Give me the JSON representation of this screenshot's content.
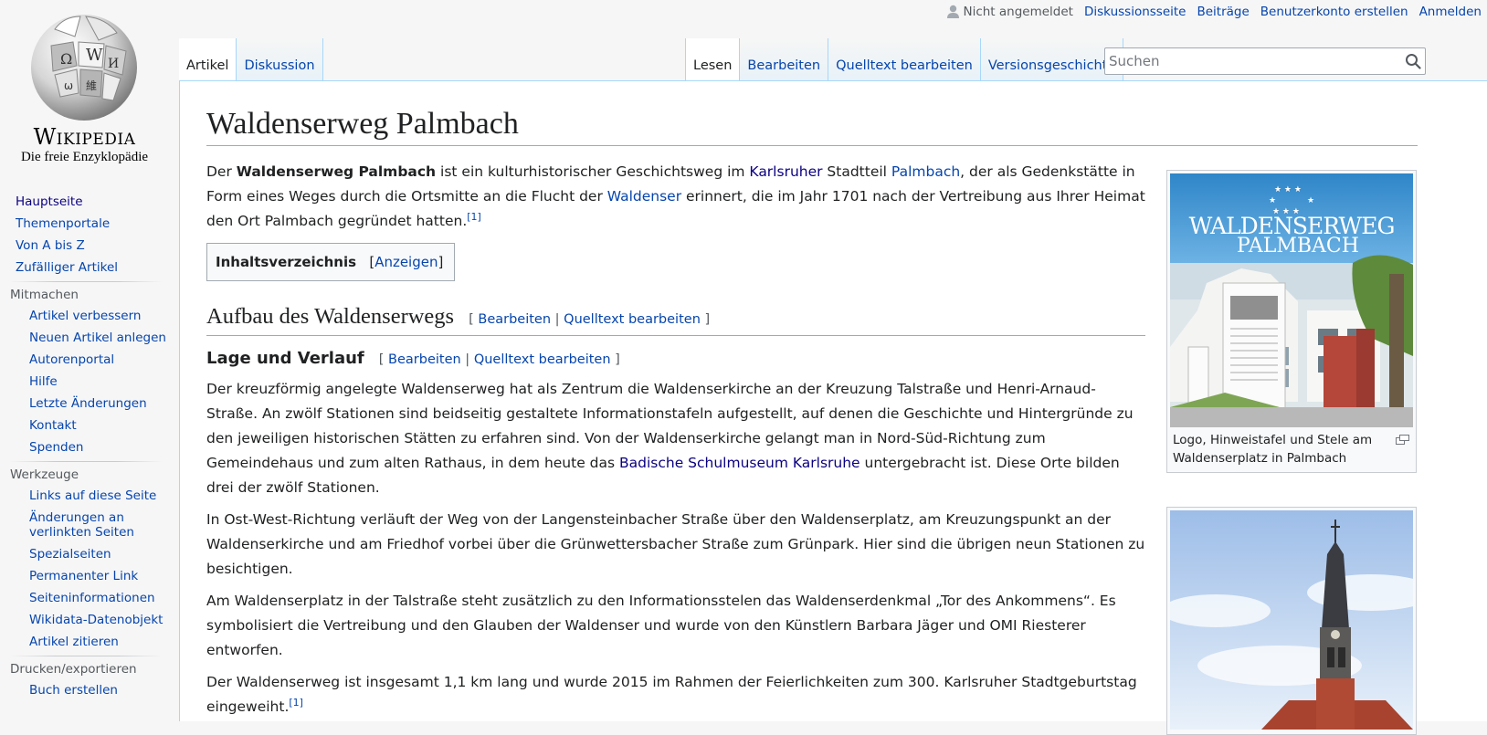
{
  "logo": {
    "wordmark": "Wikipedia",
    "tagline": "Die freie Enzyklopädie"
  },
  "personal": {
    "user_status": "Nicht angemeldet",
    "links": [
      "Diskussionsseite",
      "Beiträge",
      "Benutzerkonto erstellen",
      "Anmelden"
    ]
  },
  "tabs": {
    "namespaces": [
      {
        "label": "Artikel",
        "selected": true
      },
      {
        "label": "Diskussion",
        "selected": false
      }
    ],
    "views": [
      {
        "label": "Lesen",
        "selected": true
      },
      {
        "label": "Bearbeiten",
        "selected": false
      },
      {
        "label": "Quelltext bearbeiten",
        "selected": false
      },
      {
        "label": "Versionsgeschichte",
        "selected": false
      }
    ]
  },
  "search": {
    "placeholder": "Suchen",
    "value": ""
  },
  "sidebar": {
    "navigation": [
      "Hauptseite",
      "Themenportale",
      "Von A bis Z",
      "Zufälliger Artikel"
    ],
    "mitmachen": {
      "heading": "Mitmachen",
      "items": [
        "Artikel verbessern",
        "Neuen Artikel anlegen",
        "Autorenportal",
        "Hilfe",
        "Letzte Änderungen",
        "Kontakt",
        "Spenden"
      ]
    },
    "werkzeuge": {
      "heading": "Werkzeuge",
      "items": [
        "Links auf diese Seite",
        "Änderungen an verlinkten Seiten",
        "Spezialseiten",
        "Permanenter Link",
        "Seiteninformationen",
        "Wikidata-Datenobjekt",
        "Artikel zitieren"
      ]
    },
    "drucken": {
      "heading": "Drucken/exportieren",
      "items": [
        "Buch erstellen"
      ]
    }
  },
  "article": {
    "title": "Waldenserweg Palmbach",
    "intro": {
      "t1": "Der ",
      "bold": "Waldenserweg Palmbach",
      "t2": " ist ein kulturhistorischer Geschichtsweg im ",
      "l1": "Karlsruher",
      "t3": " Stadtteil ",
      "l2": "Palmbach",
      "t4": ", der als Gedenkstätte in Form eines Weges durch die Ortsmitte an die Flucht der ",
      "l3": "Waldenser",
      "t5": " erinnert, die im Jahr 1701 nach der Vertreibung aus Ihrer Heimat den Ort Palmbach gegründet hatten.",
      "ref": "[1]"
    },
    "toc": {
      "title": "Inhaltsverzeichnis",
      "open": "[",
      "toggle": "Anzeigen",
      "close": "]"
    },
    "edit": {
      "open": "[ ",
      "edit": "Bearbeiten",
      "sep": " | ",
      "source": "Quelltext bearbeiten",
      "close": " ]"
    },
    "section1": "Aufbau des Waldenserwegs",
    "subsection1": "Lage und Verlauf",
    "p1": {
      "t1": "Der kreuzförmig angelegte Waldenserweg hat als Zentrum die Waldenserkirche an der Kreuzung Talstraße und Henri-Arnaud-Straße. An zwölf Stationen sind beidseitig gestaltete Informationstafeln aufgestellt, auf denen die Geschichte und Hintergründe zu den jeweiligen historischen Stätten zu erfahren sind. Von der Waldenserkirche gelangt man in Nord-Süd-Richtung zum Gemeindehaus und zum alten Rathaus, in dem heute das ",
      "link": "Badische Schulmuseum Karlsruhe",
      "t2": " untergebracht ist. Diese Orte bilden drei der zwölf Stationen."
    },
    "p2": "In Ost-West-Richtung verläuft der Weg von der Langensteinbacher Straße über den Waldenserplatz, am Kreuzungspunkt an der Waldenserkirche und am Friedhof vorbei über die Grünwettersbacher Straße zum Grünpark. Hier sind die übrigen neun Stationen zu besichtigen.",
    "p3": "Am Waldenserplatz in der Talstraße steht zusätzlich zu den Informationsstelen das Waldenserdenkmal „Tor des Ankommens“. Es symbolisiert die Vertreibung und den Glauben der Waldenser und wurde von den Künstlern Barbara Jäger und OMI Riesterer entworfen.",
    "p4": {
      "text": "Der Waldenserweg ist insgesamt 1,1 km lang und wurde 2015 im Rahmen der Feierlichkeiten zum 300. Karlsruher Stadtgeburtstag eingeweiht.",
      "ref": "[1]"
    }
  },
  "thumbs": [
    {
      "logo_line1": "WaldenserWeg",
      "logo_line2": "Palmbach",
      "caption": "Logo, Hinweistafel und Stele am Waldenserplatz in Palmbach"
    },
    {
      "caption": ""
    }
  ],
  "colors": {
    "link": "#0645ad",
    "visited": "#0b0080",
    "tab_border": "#a7d7f9",
    "logo_blue": "#2f86c8"
  }
}
